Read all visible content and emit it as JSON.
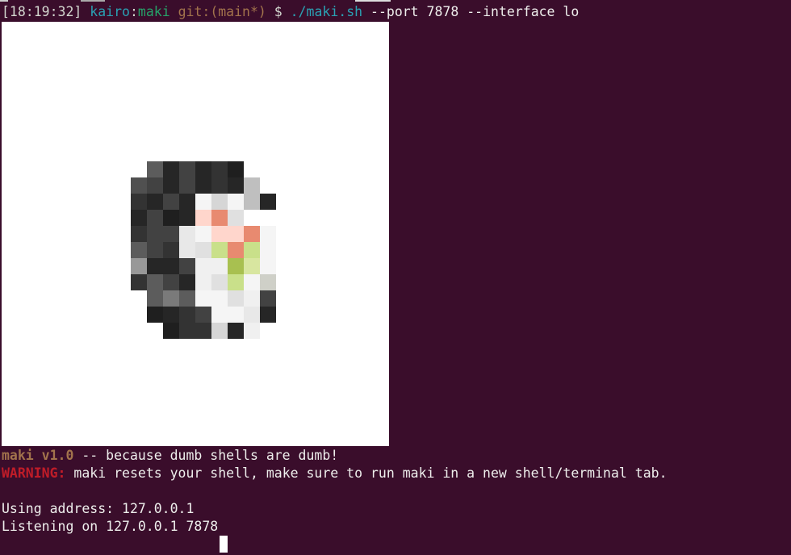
{
  "prompt": {
    "timestamp": "[18:19:32]",
    "user": "kairo",
    "sep": ":",
    "dir": "maki",
    "git": "git:(main*)",
    "dollar": "$",
    "cmd": "./maki.sh",
    "args": "--port 7878 --interface lo"
  },
  "output": {
    "banner_name": "maki v1.0",
    "banner_rest": " -- because dumb shells are dumb!",
    "warning_label": "WARNING:",
    "warning_text": " maki resets your shell, make sure to run maki in a new shell/terminal tab.",
    "address_line": "Using address: 127.0.0.1",
    "listening_line": "Listening on 127.0.0.1 7878"
  },
  "colors": {
    "background": "#3a0d2b",
    "foreground": "#eeeeec",
    "user": "#2aa1b3",
    "host": "#26a269",
    "git": "#a2734c",
    "warning": "#c01c28"
  },
  "image": {
    "description_icon": "pixelated-sushi-image",
    "palette": {
      "a": "#333333",
      "b": "#262626",
      "c": "#424242",
      "d": "#505050",
      "e": "#1f1f1f",
      "f": "#5c5c5c",
      "g": "#7a7a7a",
      "h": "#989898",
      "i": "#bfbfbf",
      "j": "#d6d6d6",
      "k": "#e8e8e8",
      "l": "#f5f5f5",
      "m": "#f0f0f0",
      "n": "#ffd6cc",
      "o": "#e88a70",
      "p": "#f4c2b0",
      "q": "#c9e08a",
      "r": "#a8c050",
      "s": "#d8e6a0",
      "t": "#e8e4a8",
      "u": "#c0c4b0",
      "v": "#f2f0c8",
      "w": "#cfd0c8",
      "x": "#ffffff",
      "y": "#e0e0e0",
      "z": "#b0b0b0"
    },
    "rows": [
      "..........",
      "...fbcbae..",
      "..dcbcbabi.",
      "..abcbljlib",
      "..bcebnoy.",
      "..accklnnol",
      "..fcakyqoql",
      "..hbbcmmrsl",
      "..afcbmyqlw",
      "...fgfllymc",
      "...ebacllkb",
      "....eaajbm."
    ]
  }
}
